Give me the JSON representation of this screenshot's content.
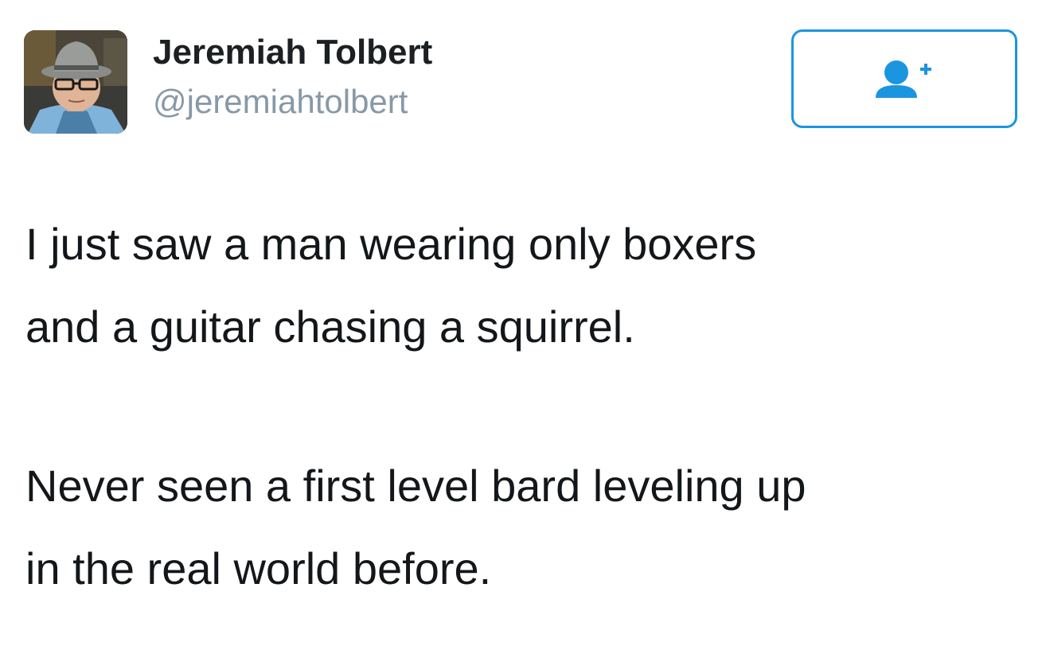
{
  "tweet": {
    "author": {
      "display_name": "Jeremiah Tolbert",
      "handle": "@jeremiahtolbert",
      "avatar_icon": "avatar-photo"
    },
    "follow_button": {
      "icon": "follow-person-plus-icon",
      "color": "#1b95e0"
    },
    "paragraphs": [
      "I just saw a man wearing only boxers\nand a guitar chasing a squirrel.",
      "Never seen a first level bard leveling up\nin the real world before."
    ]
  },
  "colors": {
    "name_text": "#1c2022",
    "handle_text": "#8899a6",
    "body_text": "#14171a",
    "accent": "#1b95e0"
  }
}
